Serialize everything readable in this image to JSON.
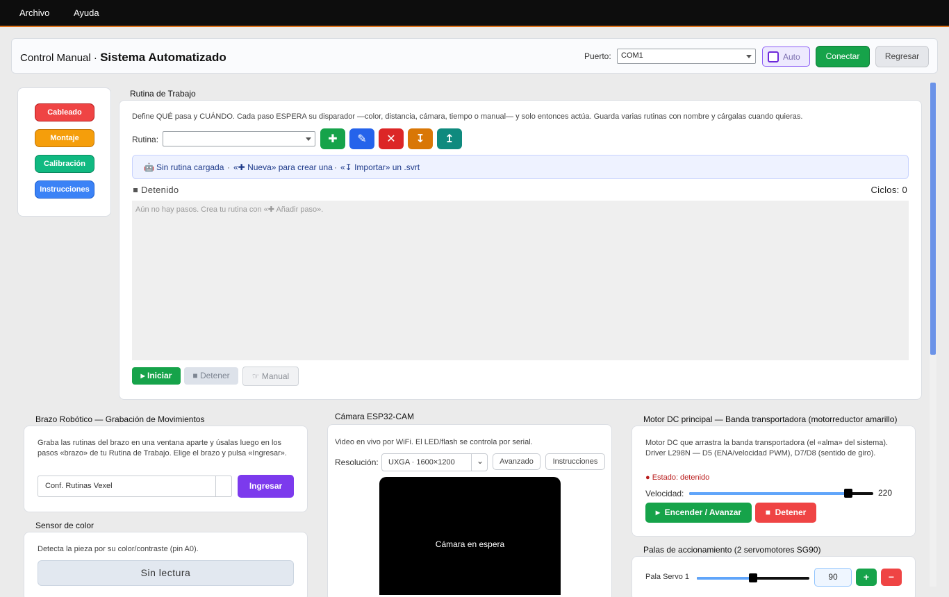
{
  "menu": {
    "items": [
      "Archivo",
      "Ayuda"
    ]
  },
  "header": {
    "title_prefix": "Control Manual · ",
    "title_bold": "Sistema Automatizado",
    "port_label": "Puerto:",
    "port_value": "COM1",
    "auto_label": "Auto",
    "connect_label": "Conectar",
    "back_label": "Regresar"
  },
  "nav": [
    {
      "label": "Cableado",
      "color": "#ef4444"
    },
    {
      "label": "Montaje",
      "color": "#f59e0b"
    },
    {
      "label": "Calibración",
      "color": "#10b981"
    },
    {
      "label": "Instrucciones",
      "color": "#3b82f6"
    }
  ],
  "routine": {
    "section_title": "Rutina de Trabajo",
    "description": "Define QUÉ pasa y CUÁNDO. Cada paso ESPERA su disparador —color, distancia, cámara, tiempo o manual— y solo entonces actúa. Guarda varias rutinas con nombre y cárgalas cuando quieras.",
    "routine_label": "Rutina:",
    "routine_value": "",
    "action_buttons": [
      {
        "icon": "plus-icon",
        "glyph": "✚",
        "color": "#16a34a"
      },
      {
        "icon": "pencil-icon",
        "glyph": "✎",
        "color": "#2563eb"
      },
      {
        "icon": "delete-x-icon",
        "glyph": "✕",
        "color": "#dc2626"
      },
      {
        "icon": "import-icon",
        "glyph": "↧",
        "color": "#d97706"
      },
      {
        "icon": "export-icon",
        "glyph": "↥",
        "color": "#0f8a7e"
      }
    ],
    "info_none": "Sin rutina cargada",
    "info_new": "«✚ Nueva» para crear una",
    "info_import": "«↧ Importar» un .svrt",
    "status": "Detenido",
    "cycles": "Ciclos: 0",
    "empty_steps": "Aún no hay pasos. Crea tu rutina con «✚ Añadir paso».",
    "start_label": "Iniciar",
    "stop_label": "Detener",
    "manual_label": "Manual"
  },
  "arm": {
    "section_title": "Brazo Robótico — Grabación de Movimientos",
    "description": "Graba las rutinas del brazo en una ventana aparte y úsalas luego en los pasos «brazo» de tu Rutina de Trabajo. Elige el brazo y pulsa «Ingresar».",
    "select_value": "Conf. Rutinas Vexel",
    "enter_label": "Ingresar"
  },
  "color_sensor": {
    "section_title": "Sensor de color",
    "description": "Detecta la pieza por su color/contraste (pin A0).",
    "reading": "Sin lectura"
  },
  "camera": {
    "section_title": "Cámara ESP32-CAM",
    "description": "Video en vivo por WiFi. El LED/flash se controla por serial.",
    "resolution_label": "Resolución:",
    "resolution_value": "UXGA · 1600×1200",
    "advanced_label": "Avanzado",
    "instructions_label": "Instrucciones",
    "standby": "Cámara en espera"
  },
  "motor": {
    "section_title": "Motor DC principal — Banda transportadora (motorreductor amarillo)",
    "description": "Motor DC que arrastra la banda transportadora (el «alma» del sistema). Driver L298N — D5 (ENA/velocidad PWM), D7/D8 (sentido de giro).",
    "status": "● Estado: detenido",
    "speed_label": "Velocidad:",
    "speed_value": "220",
    "speed_fraction": 0.8627,
    "on_label": "Encender / Avanzar",
    "stop_label": "Detener"
  },
  "paddles": {
    "section_title": "Palas de accionamiento (2 servomotores SG90)",
    "servo1_label": "Pala Servo 1",
    "servo1_value": "90",
    "servo1_fraction": 0.5,
    "plus": "+",
    "minus": "−"
  }
}
